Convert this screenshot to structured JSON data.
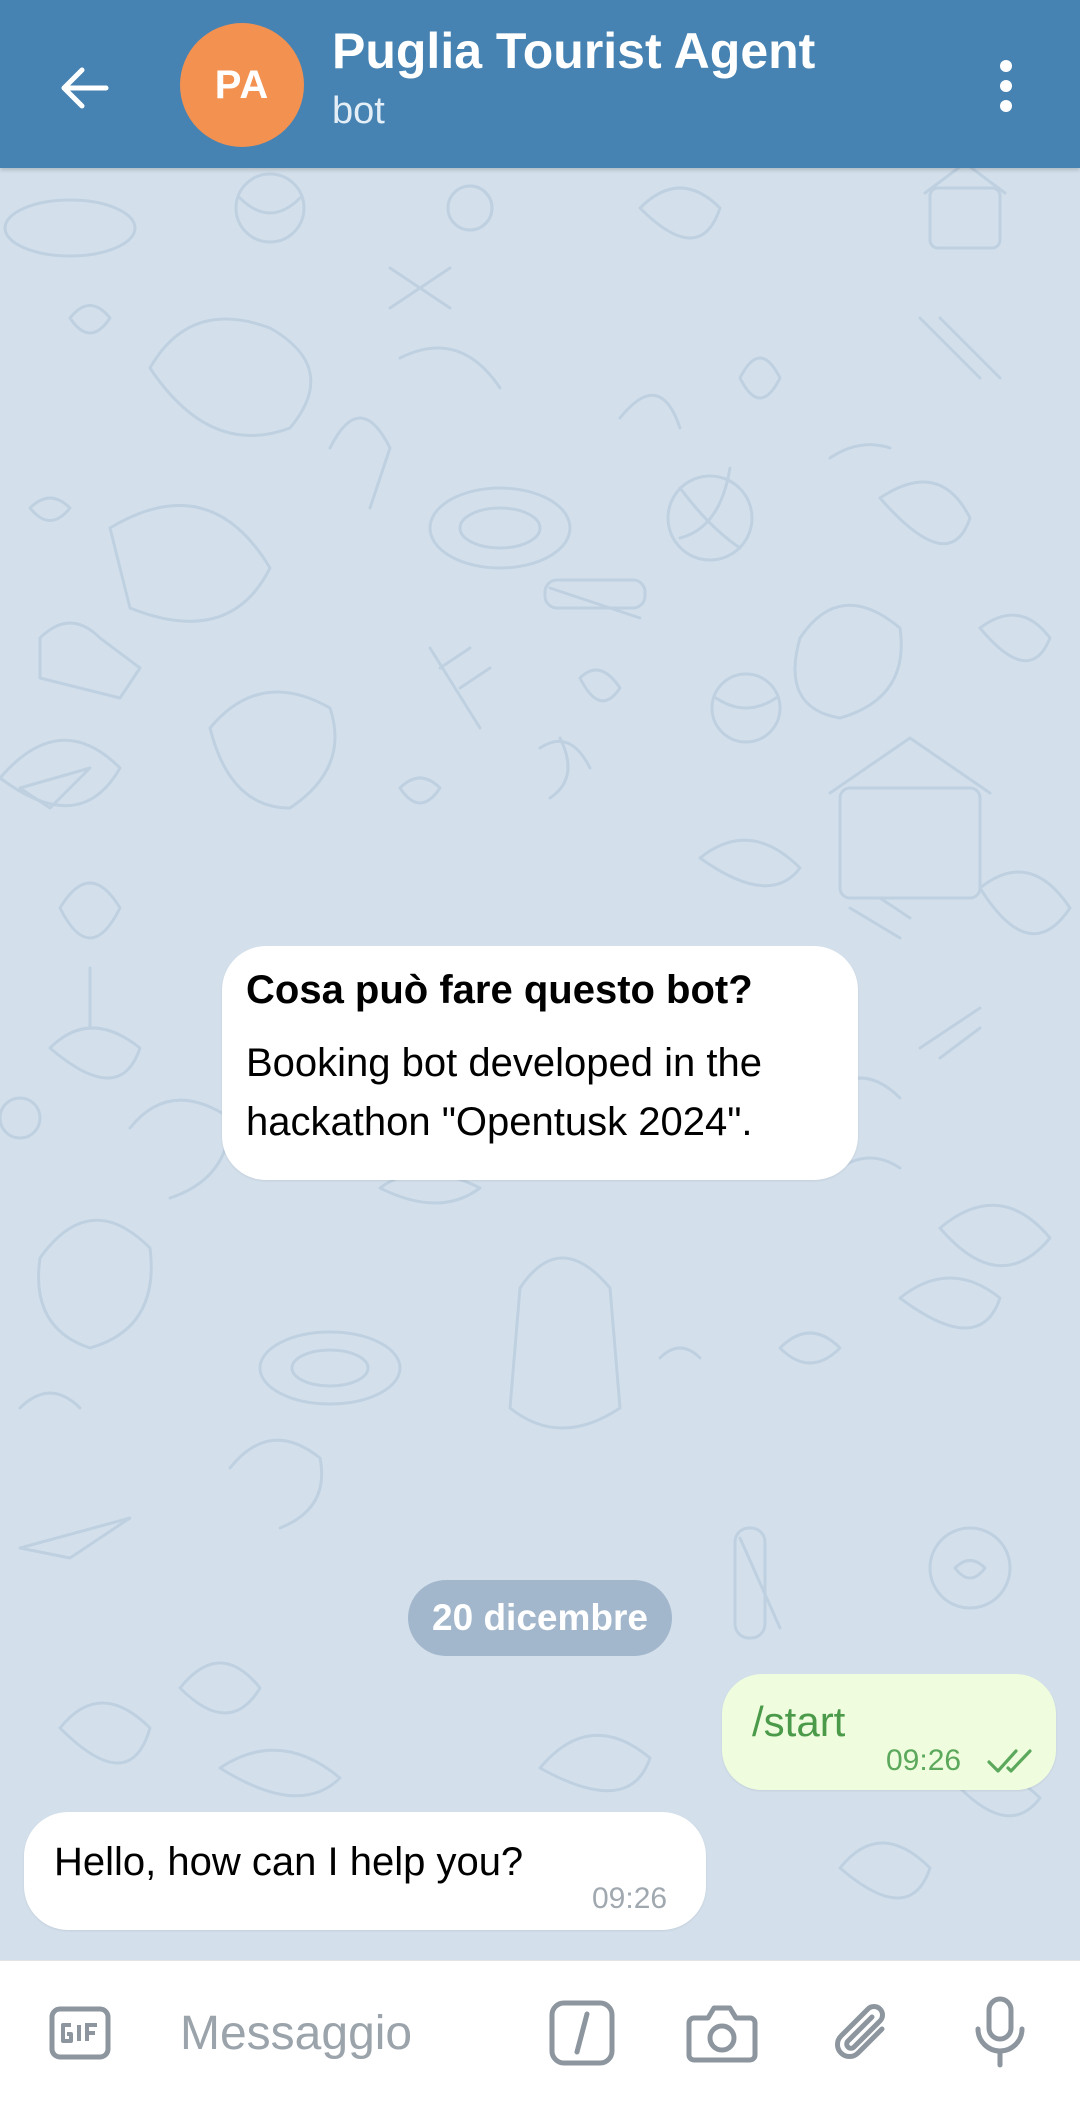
{
  "header": {
    "avatar_initials": "PA",
    "title": "Puglia Tourist Agent",
    "subtitle": "bot",
    "avatar_color": "#f39151",
    "bar_color": "#4683b2"
  },
  "info_card": {
    "title": "Cosa può fare questo bot?",
    "body": "Booking bot developed in the hackathon \"Opentusk 2024\"."
  },
  "date_separator": "20 dicembre",
  "messages": [
    {
      "direction": "outgoing",
      "text": "/start",
      "time": "09:26",
      "status": "read"
    },
    {
      "direction": "incoming",
      "text": "Hello, how can I help you?",
      "time": "09:26"
    }
  ],
  "composer": {
    "placeholder": "Messaggio",
    "icons": [
      "gif-icon",
      "slash-command-icon",
      "camera-icon",
      "paperclip-icon",
      "microphone-icon"
    ]
  }
}
